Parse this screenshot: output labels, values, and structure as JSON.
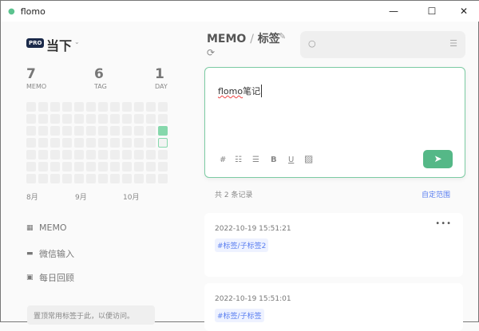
{
  "app": {
    "title": "flomo",
    "minimize": "—",
    "maximize": "☐",
    "close": "✕"
  },
  "sidebar": {
    "pro_badge": "PRO",
    "account": "当下",
    "stats": [
      {
        "value": "7",
        "label": "MEMO"
      },
      {
        "value": "6",
        "label": "TAG"
      },
      {
        "value": "1",
        "label": "DAY"
      }
    ],
    "heatmap": {
      "columns": 12,
      "rows": 7,
      "filled": [
        [
          11,
          2
        ]
      ],
      "today": [
        11,
        3
      ]
    },
    "months": [
      "8月",
      "9月",
      "10月"
    ],
    "nav": [
      {
        "icon": "grid-icon",
        "glyph": "▦",
        "label": "MEMO"
      },
      {
        "icon": "chat-icon",
        "glyph": "▬",
        "label": "微信输入"
      },
      {
        "icon": "calendar-icon",
        "glyph": "▣",
        "label": "每日回顾"
      }
    ],
    "pin_hint": "置顶常用标签于此，以便访问。"
  },
  "main": {
    "breadcrumb": {
      "root": "MEMO",
      "sep": "/",
      "current": "标签"
    },
    "editor": {
      "text_underlined": "flomo",
      "text_rest": "笔记"
    },
    "toolbar": {
      "hash": "#",
      "bold": "B",
      "underline": "U"
    },
    "count": "共 2 条记录",
    "range": "自定范围",
    "memos": [
      {
        "time": "2022-10-19 15:51:21",
        "tag": "#标签/子标签2"
      },
      {
        "time": "2022-10-19 15:51:01",
        "tag": "#标签/子标签"
      }
    ],
    "more": "•••"
  },
  "colors": {
    "accent": "#55b887",
    "link": "#5b7ff0",
    "heat": "#86d8ac"
  }
}
